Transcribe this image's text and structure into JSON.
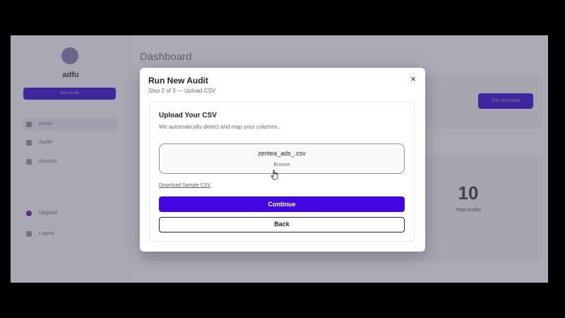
{
  "dashboard": {
    "title": "Dashboard",
    "brand_name": "adfu",
    "sidebar_cta": "New Audit",
    "nav": [
      {
        "label": "Home"
      },
      {
        "label": "Audits"
      },
      {
        "label": "Account"
      }
    ],
    "upgrade": {
      "label": "Upgrade"
    },
    "logout": {
      "label": "Logout"
    },
    "header_button": "Run New Audit",
    "stat": {
      "value": "10",
      "label": "Total Audits"
    }
  },
  "modal": {
    "title": "Run New Audit",
    "subtitle": "Step 2 of 3 — Upload CSV",
    "close_icon": "×",
    "card": {
      "title": "Upload Your CSV",
      "subtitle": "We automatically detect and map your columns.",
      "file_name": "zentea_ads_.csv",
      "browse_label": "Browse",
      "sample_link": "Download Sample CSV"
    },
    "continue_label": "Continue",
    "back_label": "Back"
  },
  "colors": {
    "accent": "#4207e0",
    "backdrop": "#000000"
  },
  "icons": [
    "close-icon",
    "pointer-hand-cursor-icon"
  ]
}
